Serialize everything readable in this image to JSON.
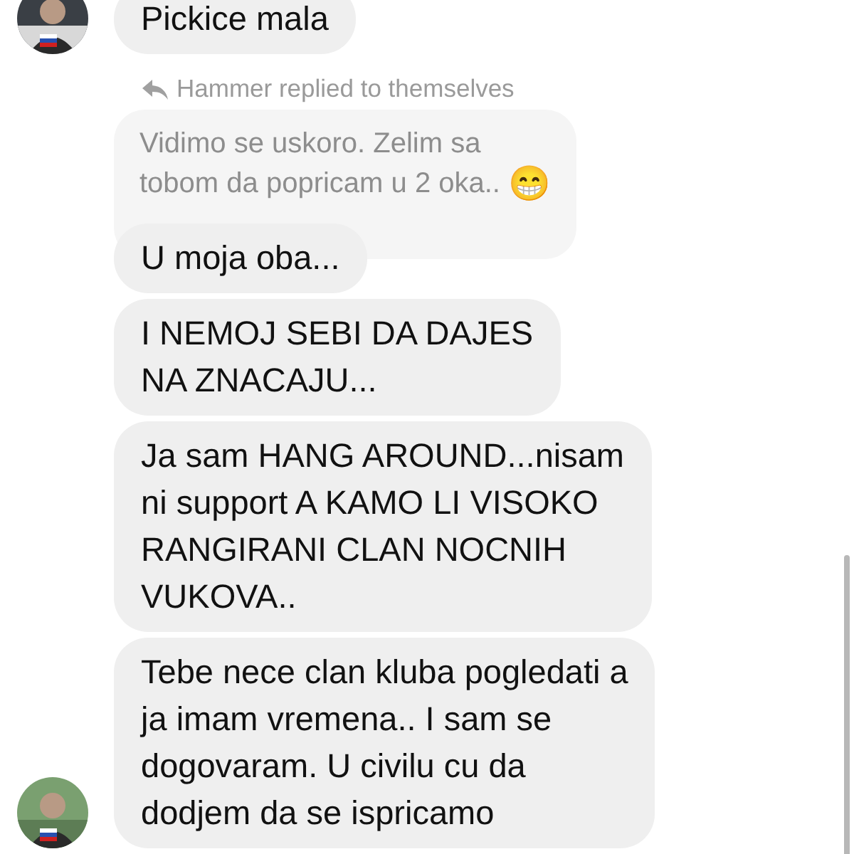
{
  "messages": [
    {
      "kind": "bubble",
      "text": "Pickice mala",
      "avatar": true
    },
    {
      "kind": "reply_header",
      "text": "Hammer replied to themselves"
    },
    {
      "kind": "quote",
      "text": "Vidimo se uskoro. Zelim sa\ntobom da popricam u 2 oka..",
      "emoji": "😁"
    },
    {
      "kind": "bubble",
      "text": "U moja oba...",
      "avatar": false
    },
    {
      "kind": "bubble",
      "text": "I NEMOJ SEBI DA DAJES\nNA ZNACAJU...",
      "avatar": false
    },
    {
      "kind": "bubble",
      "text": "Ja sam HANG AROUND...nisam\nni support A KAMO LI VISOKO\nRANGIRANI CLAN NOCNIH\nVUKOVA..",
      "avatar": false
    },
    {
      "kind": "bubble",
      "text": "Tebe nece clan kluba pogledati a\nja imam vremena.. I sam se\ndogovaram. U civilu cu da\ndodjem da se ispricamo",
      "avatar": true
    }
  ]
}
